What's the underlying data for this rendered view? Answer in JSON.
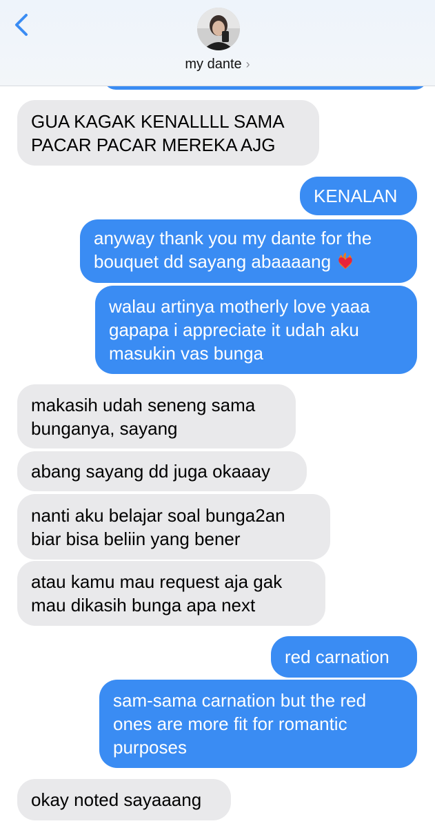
{
  "header": {
    "contact_name": "my dante",
    "chevron": "›",
    "back_icon": "chevron-left-icon"
  },
  "colors": {
    "sent_bubble": "#3a8cf3",
    "received_bubble": "#e9e9eb",
    "back_accent": "#3a8cf3"
  },
  "messages": [
    {
      "side": "received",
      "text": "GUA KAGAK KENALLLL SAMA\nPACAR PACAR MEREKA AJG"
    },
    {
      "side": "sent",
      "text": "KENALAN"
    },
    {
      "side": "sent",
      "text": "anyway thank you my dante for the\nbouquet dd sayang abaaaang",
      "emoji": "heart-on-fire-emoji"
    },
    {
      "side": "sent",
      "text": "walau artinya motherly love yaaa\ngapapa i appreciate it udah aku\nmasukin vas bunga"
    },
    {
      "side": "received",
      "text": "makasih udah seneng sama\nbunganya, sayang"
    },
    {
      "side": "received",
      "text": "abang sayang dd juga okaaay"
    },
    {
      "side": "received",
      "text": "nanti aku belajar soal bunga2an\nbiar bisa beliin yang bener"
    },
    {
      "side": "received",
      "text": "atau kamu mau request aja gak\nmau dikasih bunga apa next"
    },
    {
      "side": "sent",
      "text": "red carnation"
    },
    {
      "side": "sent",
      "text": "sam-sama carnation but the red\nones are more fit for romantic\npurposes"
    },
    {
      "side": "received",
      "text": "okay noted sayaaang"
    }
  ]
}
